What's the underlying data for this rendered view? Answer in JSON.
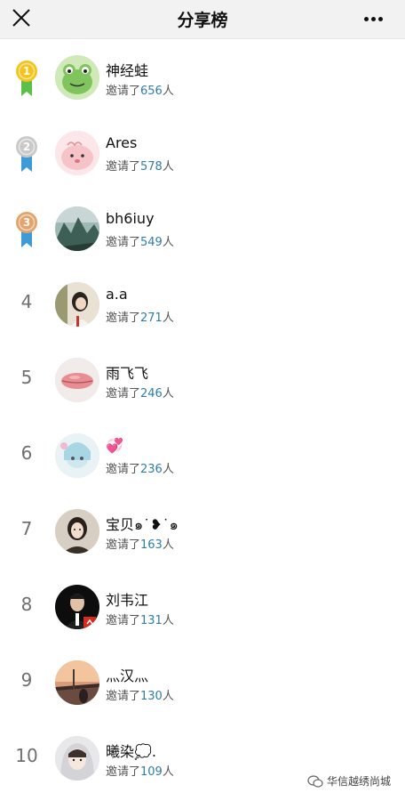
{
  "header": {
    "title": "分享榜",
    "close_icon": "close-icon",
    "more_icon": "more-dots-icon"
  },
  "ranking": [
    {
      "rank": "1",
      "medal": "gold",
      "name": "神经蛙",
      "prefix": "邀请了",
      "count": "656",
      "suffix": "人",
      "avatar": "frog"
    },
    {
      "rank": "2",
      "medal": "silver",
      "name": "Ares",
      "prefix": "邀请了",
      "count": "578",
      "suffix": "人",
      "avatar": "pink-blob"
    },
    {
      "rank": "3",
      "medal": "bronze",
      "name": "bh6iuy",
      "prefix": "邀请了",
      "count": "549",
      "suffix": "人",
      "avatar": "mountains"
    },
    {
      "rank": "4",
      "medal": "",
      "name": "a.a",
      "prefix": "邀请了",
      "count": "271",
      "suffix": "人",
      "avatar": "girl"
    },
    {
      "rank": "5",
      "medal": "",
      "name": "雨飞飞",
      "prefix": "邀请了",
      "count": "246",
      "suffix": "人",
      "avatar": "lips"
    },
    {
      "rank": "6",
      "medal": "",
      "name": "💞",
      "prefix": "邀请了",
      "count": "236",
      "suffix": "人",
      "avatar": "anime"
    },
    {
      "rank": "7",
      "medal": "",
      "name": "宝贝๑˙❥˙๑",
      "prefix": "邀请了",
      "count": "163",
      "suffix": "人",
      "avatar": "woman"
    },
    {
      "rank": "8",
      "medal": "",
      "name": "刘韦江",
      "prefix": "邀请了",
      "count": "131",
      "suffix": "人",
      "avatar": "man"
    },
    {
      "rank": "9",
      "medal": "",
      "name": "灬汉灬",
      "prefix": "邀请了",
      "count": "130",
      "suffix": "人",
      "avatar": "sunset"
    },
    {
      "rank": "10",
      "medal": "",
      "name": "曦染💭.",
      "prefix": "邀请了",
      "count": "109",
      "suffix": "人",
      "avatar": "hoodie"
    }
  ],
  "watermark": {
    "text": "华信越绣尚城",
    "icon": "wechat-icon"
  },
  "colors": {
    "count": "#2f7dac",
    "gold": "#f4c31c",
    "silver": "#c9c9c9",
    "bronze": "#e3a36b",
    "ribbon_gold": "#5bbf4a",
    "ribbon_blue": "#3d9bd8"
  }
}
